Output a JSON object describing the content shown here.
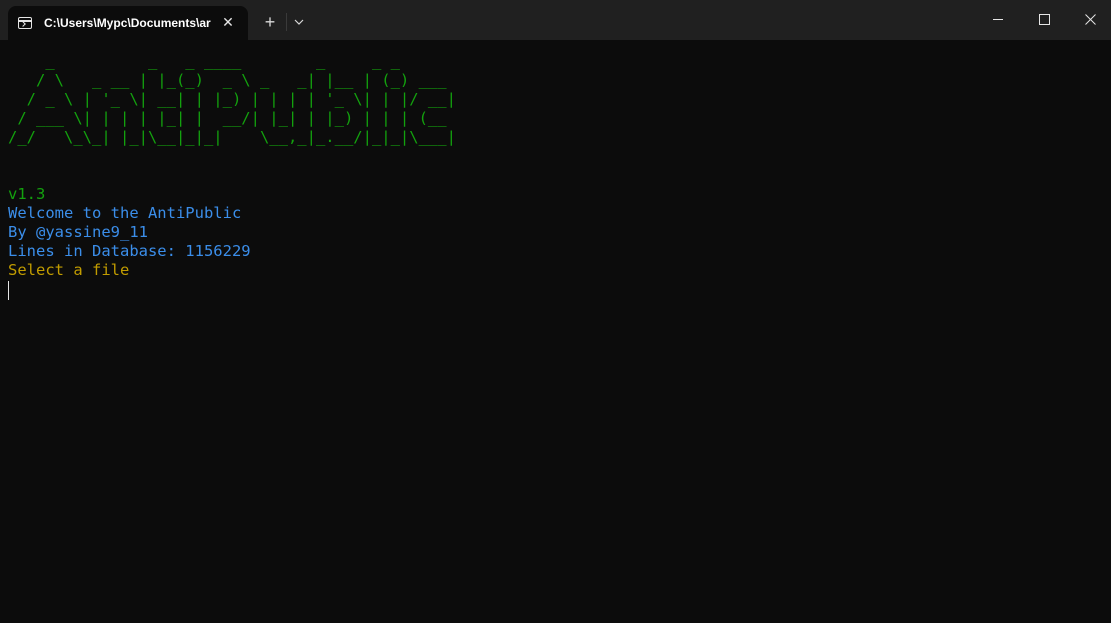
{
  "window": {
    "tab_title": "C:\\Users\\Mypc\\Documents\\ar",
    "tab_close_glyph": "✕",
    "new_tab_glyph": "+",
    "dropdown_glyph": "⌄",
    "close_glyph": "✕",
    "icons": {
      "tab": "terminal-icon",
      "minimize": "minimize-icon",
      "maximize": "maximize-icon",
      "close": "close-icon"
    }
  },
  "terminal": {
    "ascii_banner": [
      "    _          _   _ ____        _     _ _",
      "   / \\   _ __ | |_(_)  _ \\ _   _| |__ | (_) ___",
      "  / _ \\ | '_ \\| __| | |_) | | | | '_ \\| | |/ __|",
      " / ___ \\| | | | |_| |  __/| |_| | |_) | | | (__",
      "/_/   \\_\\_| |_|\\__|_|_|    \\__,_|_.__/|_|_|\\___|"
    ],
    "version": "v1.3",
    "welcome": "Welcome to the AntiPublic",
    "author": "By @yassine9_11",
    "db_lines": "Lines in Database: 1156229",
    "prompt": "Select a file"
  },
  "colors": {
    "background": "#0c0c0c",
    "titlebar": "#202020",
    "green": "#13a10e",
    "blue": "#3b8eea",
    "yellow": "#c19c00"
  }
}
